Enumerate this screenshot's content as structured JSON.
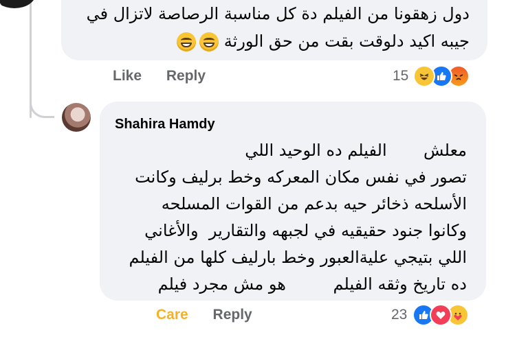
{
  "comment1": {
    "lines": [
      "دول زهقونا من الفيلم دة كل مناسبة الرصاصة لاتزال في",
      "جيبه اكيد دلوقت بقت من حق الورثة"
    ],
    "emojis": [
      "grinning-face-emoji",
      "grinning-face-emoji"
    ],
    "like_label": "Like",
    "reply_label": "Reply",
    "reaction_count": "15",
    "reactions": [
      "haha",
      "like",
      "angry"
    ]
  },
  "comment2": {
    "author": "Shahira Hamdy",
    "lines": [
      "معلش       الفيلم ده الوحيد اللي",
      "تصور في نفس مكان المعركه وخط برليف وكانت",
      "الأسلحه ذخائر حيه بدعم من القوات المسلحه",
      "وكانوا جنود حقيقيه في لجبهه والتقارير  والأغاني",
      "اللي بتيجي عليةالعبور وخط بارليف كلها من الفيلم",
      "ده تاريخ وثقه الفيلم         هو مش مجرد فيلم"
    ],
    "care_label": "Care",
    "reply_label": "Reply",
    "reaction_count": "23",
    "reactions": [
      "like",
      "love",
      "care"
    ]
  },
  "colors": {
    "bubble": "#f0f2f5",
    "action_text": "#65676b",
    "care": "#f7b125",
    "like_blue": "#1877f2",
    "love_red": "#f33e58"
  }
}
